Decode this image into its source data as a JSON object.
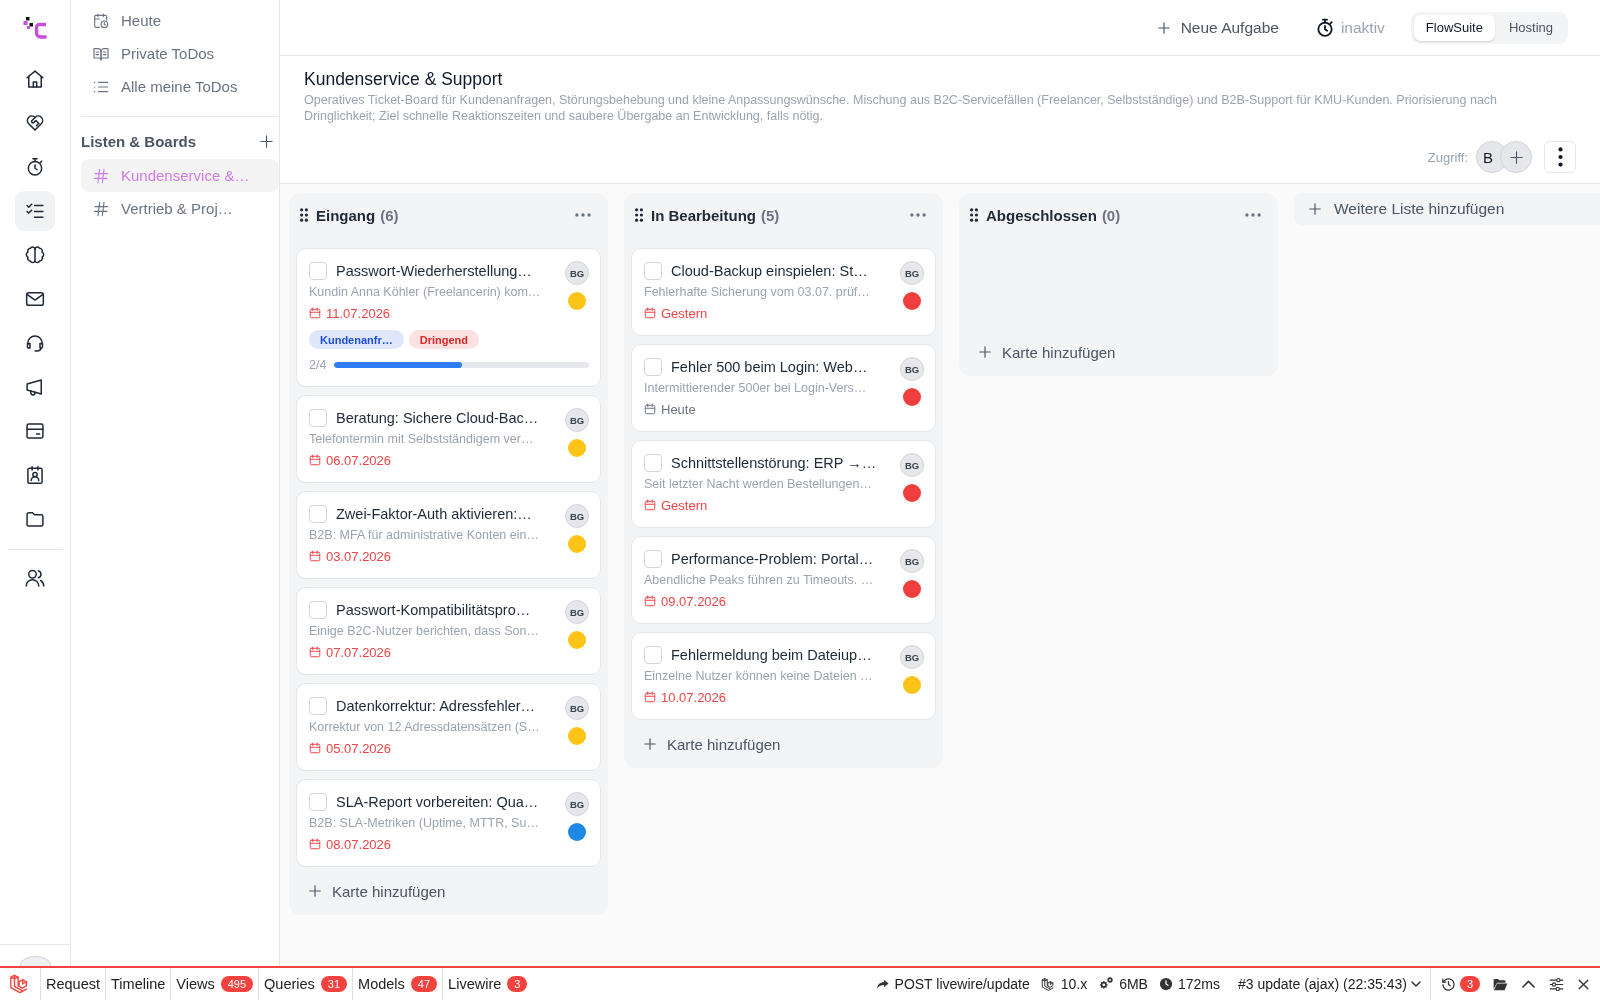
{
  "rail": {
    "items": [
      {
        "selected": false
      },
      {
        "selected": false
      },
      {
        "selected": false
      },
      {
        "selected": true
      },
      {
        "selected": false
      },
      {
        "selected": false
      },
      {
        "selected": false
      },
      {
        "selected": false
      },
      {
        "selected": false
      },
      {
        "selected": false
      },
      {
        "selected": false
      }
    ],
    "extra_items": [
      {
        "selected": false
      }
    ]
  },
  "sidebar": {
    "views": [
      {
        "label": "Heute",
        "selected": false
      },
      {
        "label": "Private ToDos",
        "selected": false
      },
      {
        "label": "Alle meine ToDos",
        "selected": false
      }
    ],
    "section_title": "Listen & Boards",
    "boards": [
      {
        "label": "Kundenservice &…",
        "selected": true
      },
      {
        "label": "Vertrieb & Proj…",
        "selected": false
      }
    ]
  },
  "topbar": {
    "new_task": "Neue Aufgabe",
    "timer": "inaktiv",
    "workspaces": [
      {
        "label": "FlowSuite",
        "selected": true
      },
      {
        "label": "Hosting",
        "selected": false
      }
    ]
  },
  "header": {
    "title": "Kundenservice & Support",
    "description": "Operatives Ticket-Board für Kundenanfragen, Störungsbehebung und kleine Anpassungswünsche. Mischung aus B2C-Servicefällen (Freelancer, Selbstständige) und B2B-Support für KMU-Kunden. Priorisierung nach Dringlichkeit; Ziel schnelle Reaktionszeiten und saubere Übergabe an Entwicklung, falls nötig.",
    "access_label": "Zugriff:",
    "members": [
      {
        "initials": "B"
      }
    ]
  },
  "board": {
    "lists": [
      {
        "title": "Eingang",
        "count": "(6)",
        "add_card": "Karte hinzufügen",
        "cards": [
          {
            "title": "Passwort-Wiederherstellung…",
            "description": "Kundin Anna Köhler (Freelancerin) kom…",
            "due": "11.07.2026",
            "overdue": true,
            "checked": false,
            "assignee": "BG",
            "color": "#fcc419",
            "tags": [
              {
                "label": "Kundenanfr…",
                "color": "#1d4ed8"
              },
              {
                "label": "Dringend",
                "color": "#dc2626"
              }
            ],
            "progress": {
              "text": "2/4",
              "level": 0.5
            }
          },
          {
            "title": "Beratung: Sichere Cloud-Bac…",
            "description": "Telefontermin mit Selbstständigem ver…",
            "due": "06.07.2026",
            "overdue": true,
            "checked": false,
            "assignee": "BG",
            "color": "#fcc419"
          },
          {
            "title": "Zwei-Faktor-Auth aktivieren:…",
            "description": "B2B: MFA für administrative Konten ein…",
            "due": "03.07.2026",
            "overdue": true,
            "checked": false,
            "assignee": "BG",
            "color": "#fcc419"
          },
          {
            "title": "Passwort-Kompatibilitätspro…",
            "description": "Einige B2C-Nutzer berichten, dass Son…",
            "due": "07.07.2026",
            "overdue": true,
            "checked": false,
            "assignee": "BG",
            "color": "#fcc419"
          },
          {
            "title": "Datenkorrektur: Adressfehler…",
            "description": "Korrektur von 12 Adressdatensätzen (S…",
            "due": "05.07.2026",
            "overdue": true,
            "checked": false,
            "assignee": "BG",
            "color": "#fcc419"
          },
          {
            "title": "SLA-Report vorbereiten: Qua…",
            "description": "B2B: SLA-Metriken (Uptime, MTTR, Su…",
            "due": "08.07.2026",
            "overdue": true,
            "checked": false,
            "assignee": "BG",
            "color": "#1e88e5"
          }
        ]
      },
      {
        "title": "In Bearbeitung",
        "count": "(5)",
        "add_card": "Karte hinzufügen",
        "cards": [
          {
            "title": "Cloud-Backup einspielen: St…",
            "description": "Fehlerhafte Sicherung vom 03.07. prüf…",
            "due": "Gestern",
            "overdue": true,
            "checked": false,
            "assignee": "BG",
            "color": "#f03e3e"
          },
          {
            "title": "Fehler 500 beim Login: Web…",
            "description": "Intermittierender 500er bei Login-Vers…",
            "due": "Heute",
            "overdue": false,
            "checked": false,
            "assignee": "BG",
            "color": "#f03e3e"
          },
          {
            "title": "Schnittstellenstörung: ERP →…",
            "description": "Seit letzter Nacht werden Bestellungen…",
            "due": "Gestern",
            "overdue": true,
            "checked": false,
            "assignee": "BG",
            "color": "#f03e3e"
          },
          {
            "title": "Performance-Problem: Portal…",
            "description": "Abendliche Peaks führen zu Timeouts. …",
            "due": "09.07.2026",
            "overdue": true,
            "checked": false,
            "assignee": "BG",
            "color": "#f03e3e"
          },
          {
            "title": "Fehlermeldung beim Dateiup…",
            "description": "Einzelne Nutzer können keine Dateien …",
            "due": "10.07.2026",
            "overdue": true,
            "checked": false,
            "assignee": "BG",
            "color": "#fcc419"
          }
        ]
      },
      {
        "title": "Abgeschlossen",
        "count": "(0)",
        "add_card": "Karte hinzufügen"
      }
    ],
    "add_list": "Weitere Liste hinzufügen"
  },
  "debugbar": {
    "tabs": [
      {
        "label": "Request",
        "selected": false
      },
      {
        "label": "Timeline",
        "selected": false
      },
      {
        "label": "Views",
        "count": "495",
        "selected": false
      },
      {
        "label": "Queries",
        "count": "31",
        "selected": false
      },
      {
        "label": "Models",
        "count": "47",
        "selected": false
      },
      {
        "label": "Livewire",
        "count": "3",
        "selected": false
      }
    ],
    "request": "POST livewire/update",
    "version": "10.x",
    "memory": "6MB",
    "duration": "172ms",
    "current_request": "#3 update (ajax) (22:35:43)",
    "history_count": "3"
  }
}
